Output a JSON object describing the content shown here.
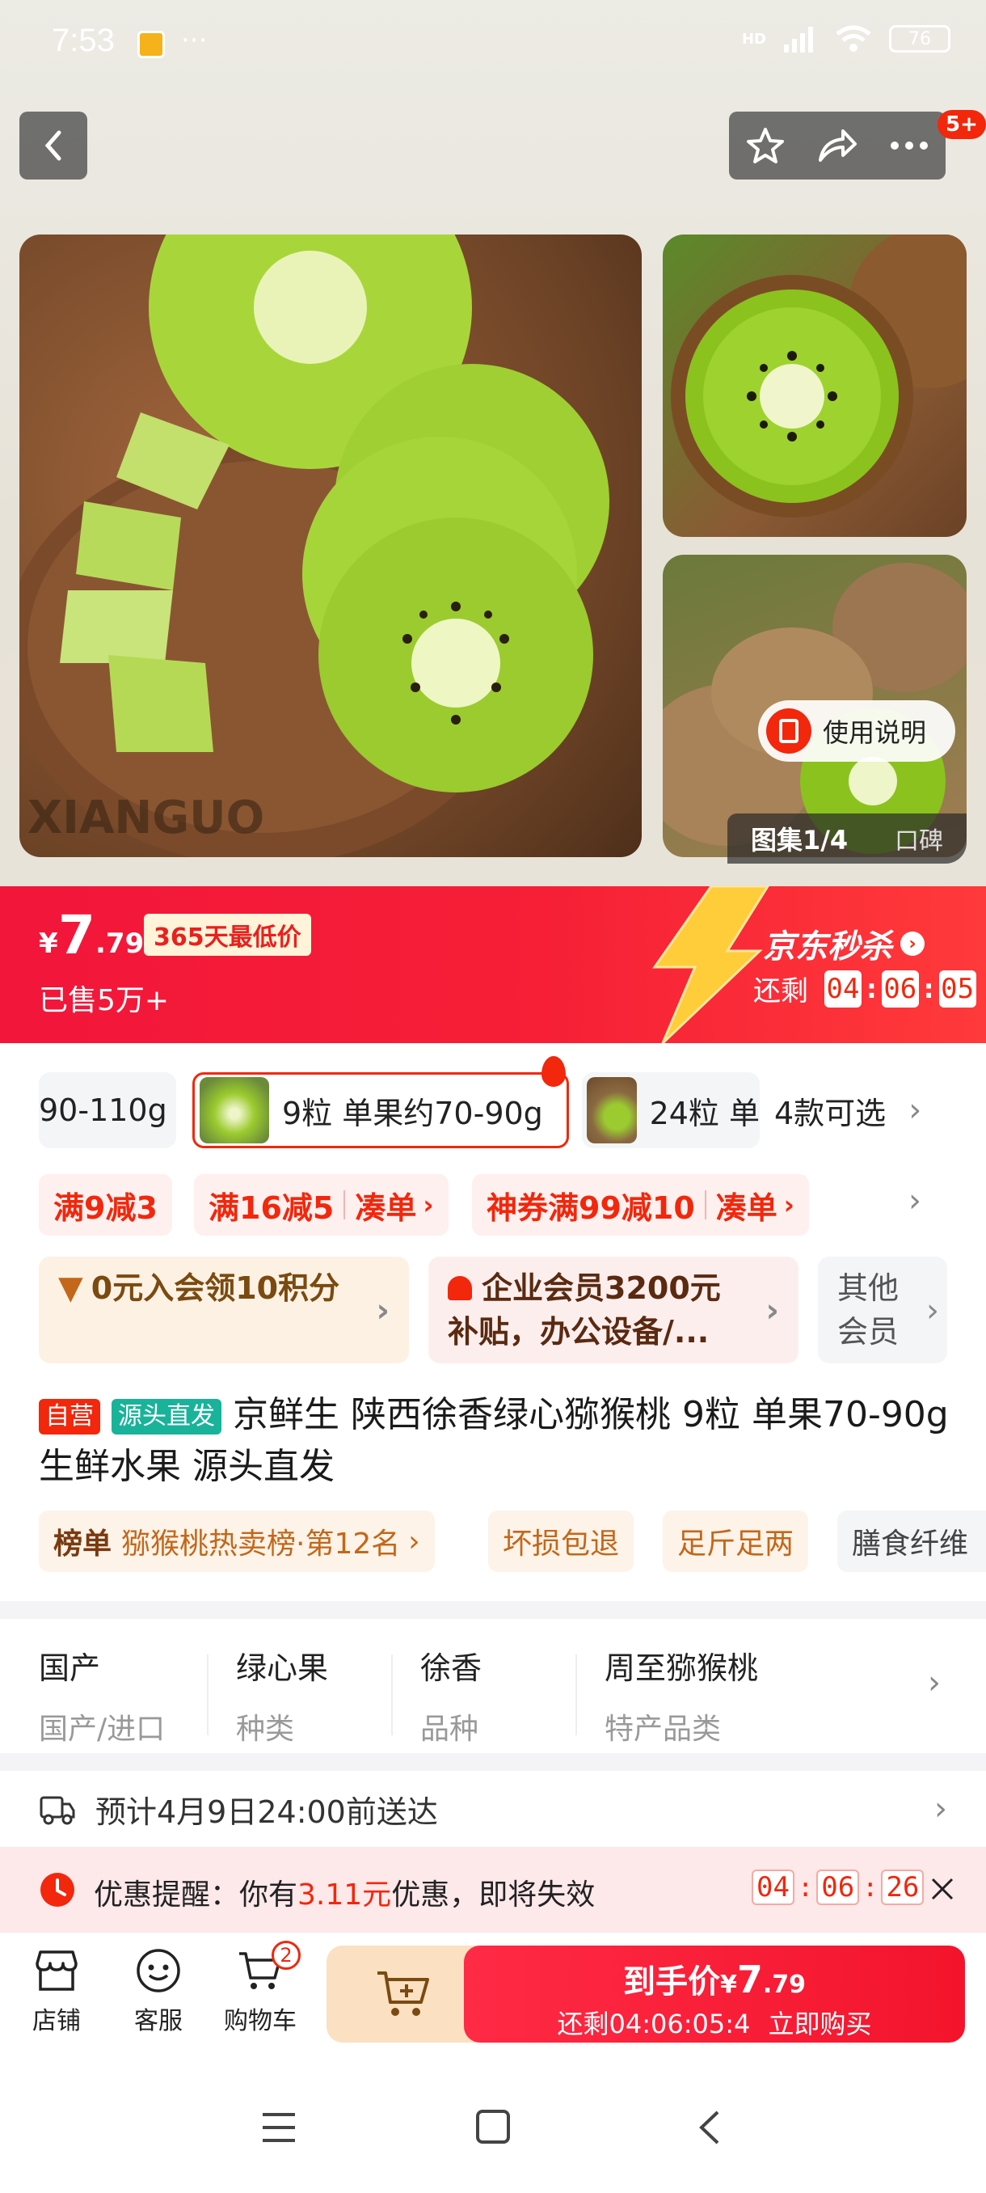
{
  "status_bar": {
    "time": "7:53",
    "dots": "···",
    "network": "HD",
    "battery": "76"
  },
  "header": {
    "badge": "5+"
  },
  "gallery": {
    "counter": "图集1/4",
    "reviews": "口碑",
    "manual_button": "使用说明",
    "watermark": "XIANGUO"
  },
  "price_band": {
    "currency": "¥",
    "price_int": "7",
    "price_dec": ".79",
    "low_price_tag": "365天最低价",
    "sold": "已售5万+",
    "seckill_title": "京东秒杀",
    "remaining_label": "还剩",
    "countdown": [
      "04",
      "06",
      "05"
    ]
  },
  "variants": {
    "items": [
      {
        "label": "90-110g"
      },
      {
        "label": "9粒 单果约70-90g"
      },
      {
        "label": "24粒 单"
      }
    ],
    "count_label": "4款可选"
  },
  "promotions": {
    "p1": "满9减3",
    "p2": "满16减5",
    "p2_action": "凑单",
    "p3": "神券满99减10",
    "p3_action": "凑单"
  },
  "membership": {
    "m1": "0元入会领10积分",
    "m2": "企业会员3200元补贴，办公设备/...",
    "m3": "其他会员"
  },
  "product": {
    "tag_self": "自营",
    "tag_source": "源头直发",
    "title": "京鲜生 陕西徐香绿心猕猴桃 9粒 单果70-90g 生鲜水果 源头直发"
  },
  "chips": {
    "rank_prefix": "榜单",
    "rank_text": "猕猴桃热卖榜·第12名",
    "c2": "坏损包退",
    "c3": "足斤足两",
    "c4": "膳食纤维"
  },
  "attributes": [
    {
      "value": "国产",
      "key": "国产/进口"
    },
    {
      "value": "绿心果",
      "key": "种类"
    },
    {
      "value": "徐香",
      "key": "品种"
    },
    {
      "value": "周至猕猴桃",
      "key": "特产品类"
    }
  ],
  "delivery": {
    "text": "预计4月9日24:00前送达"
  },
  "reminder": {
    "prefix": "优惠提醒：你有",
    "amount": "3.11元",
    "suffix": "优惠，即将失效",
    "countdown": [
      "04",
      "06",
      "26"
    ]
  },
  "bottom_bar": {
    "store": "店铺",
    "service": "客服",
    "cart": "购物车",
    "cart_count": "2",
    "buy_price_label": "到手价",
    "buy_currency": "¥",
    "buy_int": "7",
    "buy_dec": ".79",
    "buy_countdown": "还剩04:06:05:4",
    "buy_action": "立即购买"
  },
  "colors": {
    "accent": "#f2270c",
    "band": "#f2163a",
    "kiwi_green": "#9bcc2c"
  }
}
